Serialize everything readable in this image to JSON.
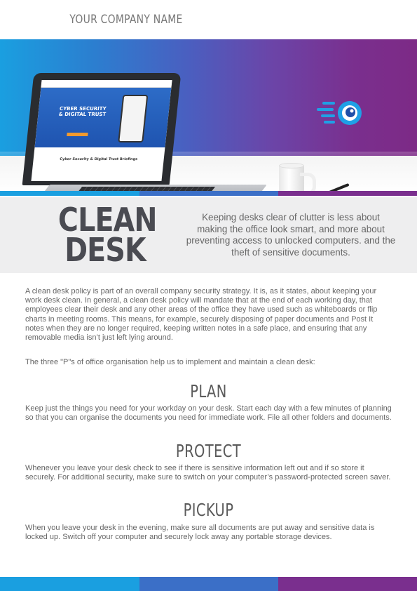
{
  "header": {
    "company_name": "YOUR COMPANY NAME"
  },
  "banner": {
    "laptop_screen_title_line1": "CYBER SECURITY",
    "laptop_screen_title_line2": "& DIGITAL TRUST",
    "laptop_screen_subtitle": "Cyber Security & Digital Trust Briefings",
    "colors": {
      "blue": "#1a9fe0",
      "mid": "#3b6fc7",
      "purple": "#7a2f8e"
    },
    "eye_logo_icon": "eye-icon"
  },
  "intro": {
    "title_line1": "CLEAN",
    "title_line2": "DESK",
    "tagline": "Keeping desks clear of clutter is less about making the office look smart, and more about preventing access to  unlocked computers. and the theft of sensitive documents."
  },
  "body": {
    "paragraph1": "A clean desk policy is part of an overall company security strategy. It is, as it states, about keeping your work desk clean. In general, a clean desk policy will mandate that at the end of each working day, that employees clear their desk and any other areas of the office they have used such as whiteboards or flip charts in meeting rooms. This means, for example, securely disposing of paper documents and Post It notes when they are no longer required, keeping written notes in a safe place, and ensuring that any removable media isn’t just left lying around.",
    "paragraph2": "The three \"P\"s of office organisation help us to implement and maintain a clean desk:",
    "sections": [
      {
        "heading": "PLAN",
        "text": "Keep just the things you need for your workday on your desk. Start each day with a few minutes of planning so that you can organise the documents you need for immediate work. File all other folders and documents."
      },
      {
        "heading": "PROTECT",
        "text": "Whenever you leave your desk check to see if there is sensitive information left out and if so store it securely. For additional security, make sure to switch on your computer’s password-protected screen saver."
      },
      {
        "heading": "PICKUP",
        "text": "When you leave your desk in the evening, make sure all documents are put away and sensitive data is locked up. Switch off your computer and securely lock away any portable storage devices."
      }
    ]
  }
}
